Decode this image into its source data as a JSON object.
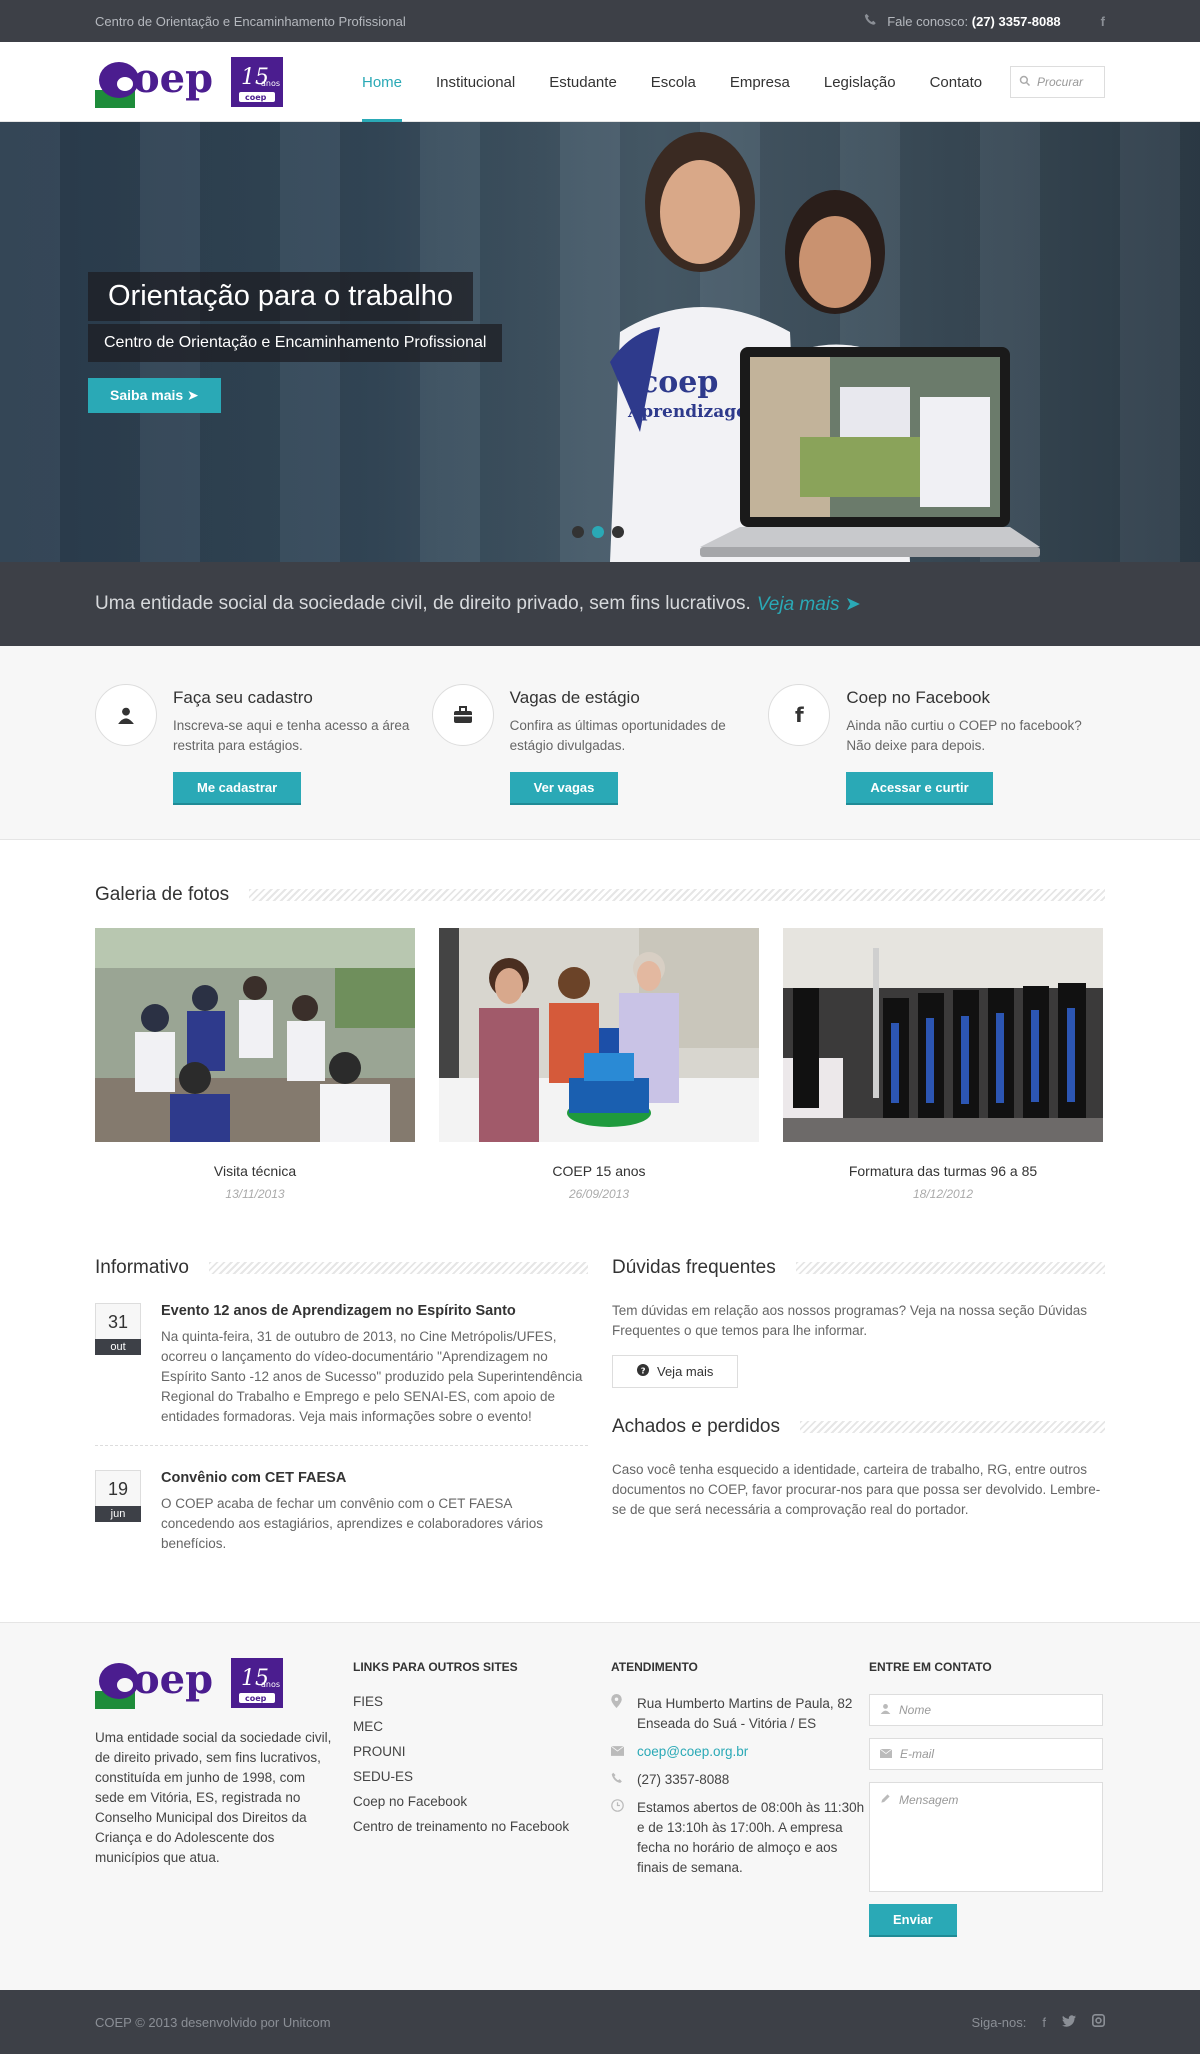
{
  "topbar": {
    "tagline": "Centro de Orientação e Encaminhamento Profissional",
    "phone_label": "Fale conosco:",
    "phone_number": "(27) 3357-8088"
  },
  "logo": {
    "text": "coep",
    "badge_number": "15",
    "badge_word": "anos",
    "badge_small": "coep"
  },
  "nav": {
    "items": [
      "Home",
      "Institucional",
      "Estudante",
      "Escola",
      "Empresa",
      "Legislação",
      "Contato"
    ],
    "active_index": 0
  },
  "search": {
    "placeholder": "Procurar"
  },
  "hero": {
    "title": "Orientação para o trabalho",
    "subtitle": "Centro de Orientação e Encaminhamento Profissional",
    "button": "Saiba mais",
    "active_slide": 1
  },
  "tagline": {
    "text": "Uma entidade social da sociedade civil, de direito privado, sem fins lucrativos.",
    "link": "Veja mais"
  },
  "features": [
    {
      "icon": "user-icon",
      "title": "Faça seu cadastro",
      "text": "Inscreva-se aqui e tenha acesso a área restrita para estágios.",
      "button": "Me cadastrar"
    },
    {
      "icon": "briefcase-icon",
      "title": "Vagas de estágio",
      "text": "Confira as últimas oportunidades de estágio divulgadas.",
      "button": "Ver vagas"
    },
    {
      "icon": "facebook-icon",
      "title": "Coep no Facebook",
      "text": "Ainda não curtiu o COEP no facebook? Não deixe para depois.",
      "button": "Acessar e curtir"
    }
  ],
  "gallery": {
    "heading": "Galeria de fotos",
    "items": [
      {
        "caption": "Visita técnica",
        "date": "13/11/2013"
      },
      {
        "caption": "COEP 15 anos",
        "date": "26/09/2013"
      },
      {
        "caption": "Formatura das turmas 96 a 85",
        "date": "18/12/2012"
      }
    ]
  },
  "informativo": {
    "heading": "Informativo",
    "items": [
      {
        "day": "31",
        "month": "out",
        "title": "Evento 12 anos de Aprendizagem no Espírito Santo",
        "text": "Na quinta-feira, 31 de outubro de 2013, no Cine Metrópolis/UFES, ocorreu o lançamento do vídeo-documentário \"Aprendizagem no Espírito Santo -12 anos de Sucesso\" produzido pela Superintendência Regional do Trabalho e Emprego e pelo SENAI-ES, com apoio de entidades formadoras. Veja mais informações sobre o evento!"
      },
      {
        "day": "19",
        "month": "jun",
        "title": "Convênio com CET FAESA",
        "text": "O COEP acaba de fechar um convênio com o CET FAESA concedendo aos estagiários, aprendizes e colaboradores vários benefícios."
      }
    ]
  },
  "duvidas": {
    "heading": "Dúvidas frequentes",
    "text": "Tem dúvidas em relação aos nossos programas? Veja na nossa seção Dúvidas Frequentes o que temos para lhe informar.",
    "button": "Veja mais"
  },
  "achados": {
    "heading": "Achados e perdidos",
    "text": "Caso você tenha esquecido a identidade, carteira de trabalho, RG, entre outros documentos no COEP, favor procurar-nos para que possa ser devolvido. Lembre-se de que será necessária a comprovação real do portador."
  },
  "footer": {
    "about": "Uma entidade social da sociedade civil, de direito privado, sem fins lucrativos, constituída em junho de 1998, com sede em Vitória, ES, registrada no Conselho Municipal dos Direitos da Criança e do Adolescente dos municípios que atua.",
    "links_heading": "LINKS PARA OUTROS SITES",
    "links": [
      "FIES",
      "MEC",
      "PROUNI",
      "SEDU-ES",
      "Coep no Facebook",
      "Centro de treinamento no Facebook"
    ],
    "atendimento_heading": "ATENDIMENTO",
    "address": "Rua Humberto Martins de Paula, 82 Enseada do Suá - Vitória / ES",
    "email": "coep@coep.org.br",
    "phone": "(27) 3357-8088",
    "hours": "Estamos abertos de 08:00h às 11:30h e de 13:10h às 17:00h. A empresa fecha no horário de almoço e aos finais de semana.",
    "contact_heading": "ENTRE EM CONTATO",
    "name_placeholder": "Nome",
    "email_placeholder": "E-mail",
    "message_placeholder": "Mensagem",
    "send": "Enviar"
  },
  "bottombar": {
    "copyright": "COEP © 2013 desenvolvido por Unitcom",
    "follow": "Siga-nos:"
  },
  "colors": {
    "accent": "#2aa9b6",
    "dark": "#3d4047",
    "logo_purple": "#4b1d8f",
    "logo_green": "#1e8c3a"
  }
}
